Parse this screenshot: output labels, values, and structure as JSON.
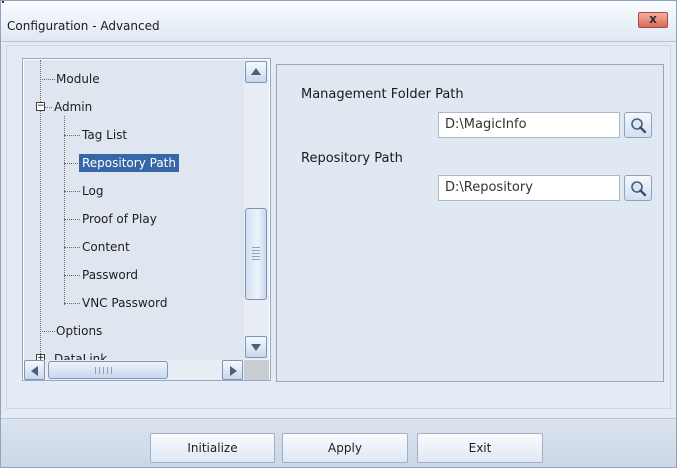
{
  "window": {
    "title": "Configuration - Advanced",
    "close_label": "x"
  },
  "tree": {
    "items": [
      {
        "label": "Module",
        "selected": false
      },
      {
        "label": "Admin",
        "selected": false,
        "expanded": true
      },
      {
        "label": "Tag List",
        "selected": false
      },
      {
        "label": "Repository Path",
        "selected": true
      },
      {
        "label": "Log",
        "selected": false
      },
      {
        "label": "Proof of Play",
        "selected": false
      },
      {
        "label": "Content",
        "selected": false
      },
      {
        "label": "Password",
        "selected": false
      },
      {
        "label": "VNC Password",
        "selected": false
      },
      {
        "label": "Options",
        "selected": false
      },
      {
        "label": "DataLink",
        "selected": false
      }
    ]
  },
  "settings": {
    "management_label": "Management Folder Path",
    "management_value": "D:\\MagicInfo",
    "repository_label": "Repository Path",
    "repository_value": "D:\\Repository"
  },
  "buttons": {
    "initialize": "Initialize",
    "apply": "Apply",
    "exit": "Exit"
  },
  "icons": {
    "browse": "magnifier-icon",
    "expander": "minus-expander-icon"
  },
  "colors": {
    "selection": "#3667a9",
    "window_bg": "#e4ebf4",
    "close": "#d96a57"
  }
}
